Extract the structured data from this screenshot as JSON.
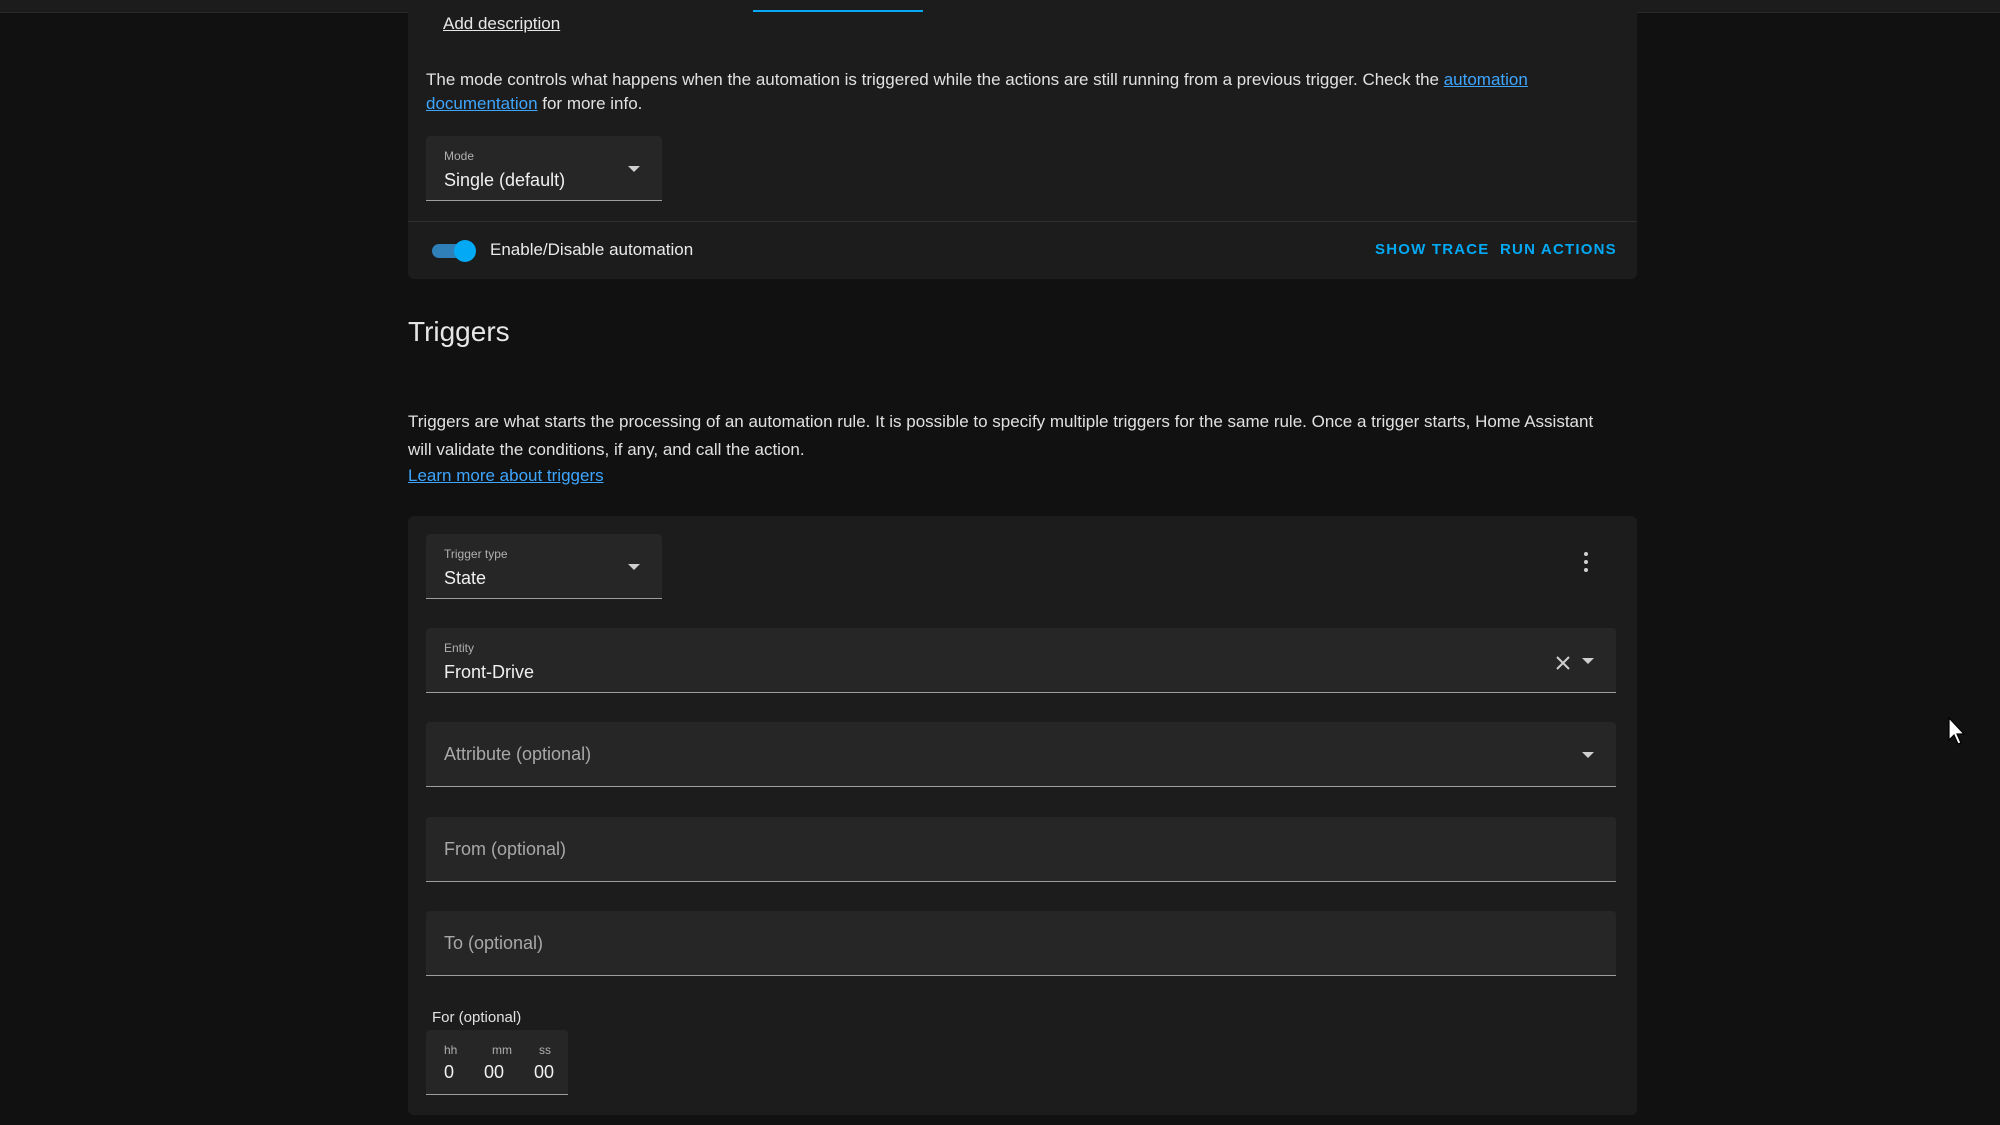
{
  "header": {
    "add_description": "Add description"
  },
  "mode_section": {
    "text_before": "The mode controls what happens when the automation is triggered while the actions are still running from a previous trigger. Check the ",
    "doc_link": "automation documentation",
    "text_after": " for more info.",
    "mode_field": {
      "label": "Mode",
      "value": "Single (default)"
    }
  },
  "actions_bar": {
    "toggle_label": "Enable/Disable automation",
    "toggle_on": true,
    "show_trace": "SHOW TRACE",
    "run_actions": "RUN ACTIONS"
  },
  "triggers": {
    "title": "Triggers",
    "description": "Triggers are what starts the processing of an automation rule. It is possible to specify multiple triggers for the same rule. Once a trigger starts, Home Assistant will validate the conditions, if any, and call the action.",
    "learn_more": "Learn more about triggers"
  },
  "trigger_card": {
    "trigger_type": {
      "label": "Trigger type",
      "value": "State"
    },
    "entity": {
      "label": "Entity",
      "value": "Front-Drive"
    },
    "attribute_placeholder": "Attribute (optional)",
    "from_placeholder": "From (optional)",
    "to_placeholder": "To (optional)",
    "for_label": "For (optional)",
    "duration": {
      "hh_label": "hh",
      "hh": "0",
      "mm_label": "mm",
      "mm": "00",
      "ss_label": "ss",
      "ss": "00"
    }
  },
  "colors": {
    "accent": "#03a9f4",
    "background": "#111111",
    "card": "#1c1c1c",
    "field": "#262626"
  },
  "icons": {
    "dropdown": "chevron-down-icon",
    "menu": "more-vertical-icon",
    "clear": "close-icon",
    "cursor": "mouse-pointer-icon"
  }
}
